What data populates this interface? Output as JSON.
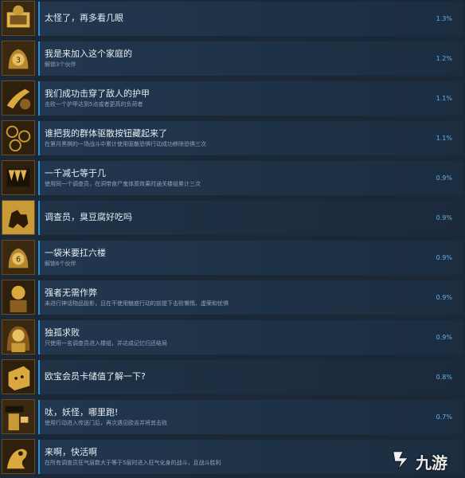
{
  "achievements": [
    {
      "title": "太怪了，再多看几眼",
      "desc": "",
      "pct": "1.3%",
      "icon": "eye-reading-icon"
    },
    {
      "title": "我是来加入这个家庭的",
      "desc": "解锁3个伙伴",
      "pct": "1.2%",
      "icon": "badge-three-icon"
    },
    {
      "title": "我们成功击穿了敌人的护甲",
      "desc": "击败一个护甲达到5点或者更高的负荷者",
      "pct": "1.1%",
      "icon": "claw-strike-icon"
    },
    {
      "title": "谁把我的群体驱散按钮藏起来了",
      "desc": "在第月黑棋的一场战斗中累计使用驱散恐惧行动成功移除恐惧三次",
      "pct": "1.1%",
      "icon": "spiral-icon"
    },
    {
      "title": "一千减七等于几",
      "desc": "使用同一个调查员，在洞带食尸鬼体质效果时通关楼组累计三次",
      "pct": "0.9%",
      "icon": "fanged-mouth-icon"
    },
    {
      "title": "调查员，臭豆腐好吃吗",
      "desc": "",
      "pct": "0.9%",
      "icon": "dog-silhouette-icon"
    },
    {
      "title": "一袋米要扛六楼",
      "desc": "解锁6个伙伴",
      "pct": "0.9%",
      "icon": "badge-six-icon"
    },
    {
      "title": "强者无需作弊",
      "desc": "未进行神话物品投影，且在不使用魅惑行动的前提下击败懒惰、虚荣和忧惧",
      "pct": "0.9%",
      "icon": "portrait-icon"
    },
    {
      "title": "独孤求败",
      "desc": "只使用一名调查员进入楼组，并达成记忆归还结局",
      "pct": "0.9%",
      "icon": "woman-portrait-icon"
    },
    {
      "title": "欧宝会员卡储值了解一下?",
      "desc": "",
      "pct": "0.8%",
      "icon": "box-face-icon"
    },
    {
      "title": "呔，妖怪，哪里跑!",
      "desc": "使用行动进入传送门后，再次遇见欧吉并将其击败",
      "pct": "0.7%",
      "icon": "exit-door-icon"
    },
    {
      "title": "来啊，快活啊",
      "desc": "在所有调查员狂气层数大于等于5层时进入狂气化身的战斗，且战斗胜利",
      "pct": "",
      "icon": "tentacle-icon"
    }
  ],
  "watermark": {
    "text": "九游",
    "icon": "jiuyou-logo-icon"
  }
}
